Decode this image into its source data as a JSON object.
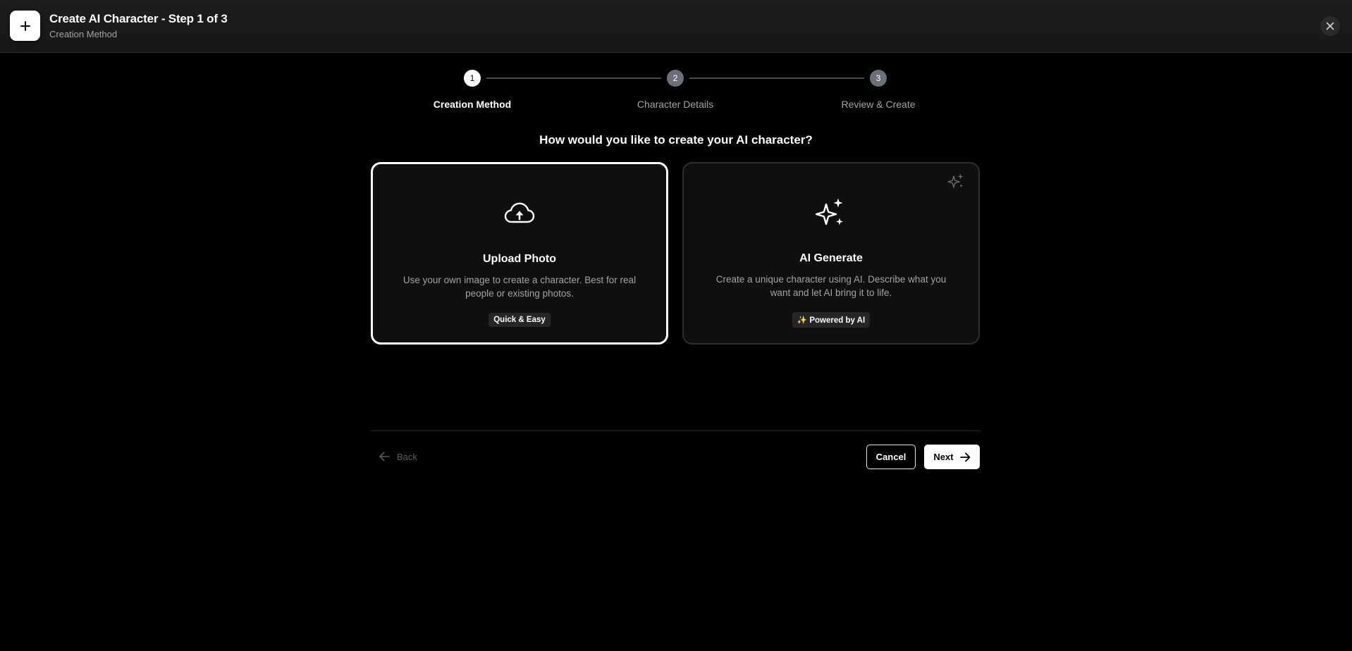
{
  "header": {
    "title": "Create AI Character - Step 1 of 3",
    "subtitle": "Creation Method",
    "icon": "plus-icon",
    "close_icon": "close-icon"
  },
  "stepper": {
    "steps": [
      {
        "number": "1",
        "label": "Creation Method",
        "state": "active"
      },
      {
        "number": "2",
        "label": "Character Details",
        "state": "inactive"
      },
      {
        "number": "3",
        "label": "Review & Create",
        "state": "inactive"
      }
    ]
  },
  "question": "How would you like to create your AI character?",
  "options": [
    {
      "title": "Upload Photo",
      "description": "Use your own image to create a character. Best for real people or existing photos.",
      "badge": "Quick & Easy",
      "icon": "cloud-upload-icon",
      "selected": true
    },
    {
      "title": "AI Generate",
      "description": "Create a unique character using AI. Describe what you want and let AI bring it to life.",
      "badge": "✨ Powered by AI",
      "icon": "sparkles-icon",
      "selected": false
    }
  ],
  "footer": {
    "back_label": "Back",
    "cancel_label": "Cancel",
    "next_label": "Next"
  },
  "colors": {
    "background": "#000000",
    "header_bg": "#1a1a1a",
    "accent": "#ffffff",
    "muted_text": "#a3a3a3",
    "inactive_step": "#6b6f78"
  }
}
